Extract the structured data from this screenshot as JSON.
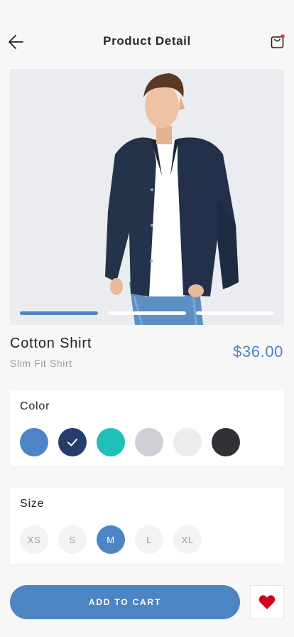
{
  "header": {
    "title": "Product Detail",
    "back_icon": "arrow-left-icon",
    "cart_icon": "shopping-bag-icon",
    "cart_badge_color": "#e53935"
  },
  "gallery": {
    "slides": 3,
    "active_index": 0
  },
  "product": {
    "name": "Cotton Shirt",
    "subtitle": "Slim Fit Shirt",
    "price": "$36.00"
  },
  "color": {
    "label": "Color",
    "options": [
      {
        "hex": "#4d84c4",
        "selected": false
      },
      {
        "hex": "#263d6b",
        "selected": true
      },
      {
        "hex": "#1fc0b8",
        "selected": false
      },
      {
        "hex": "#ced0d6",
        "selected": false
      },
      {
        "hex": "#ececee",
        "selected": false
      },
      {
        "hex": "#313236",
        "selected": false
      }
    ]
  },
  "size": {
    "label": "Size",
    "options": [
      "XS",
      "S",
      "M",
      "L",
      "XL"
    ],
    "selected": "M"
  },
  "actions": {
    "add_to_cart": "ADD TO CART",
    "favorite_icon": "heart-icon",
    "favorite_color": "#d0021b"
  },
  "colors": {
    "accent": "#4d84c4",
    "background": "#f7f7f8"
  }
}
